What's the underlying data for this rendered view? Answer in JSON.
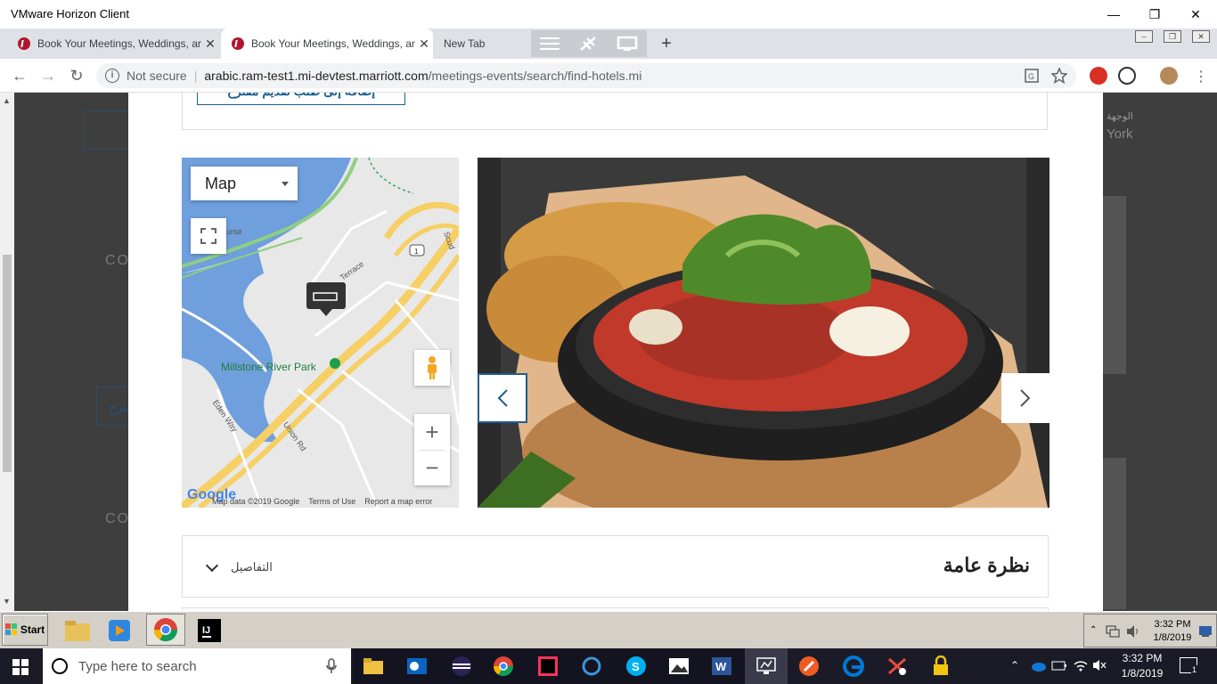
{
  "vmware": {
    "title": "VMware Horizon Client"
  },
  "tabs": [
    {
      "title": "Book Your Meetings, Weddings, and",
      "active": false
    },
    {
      "title": "Book Your Meetings, Weddings, and",
      "active": true
    },
    {
      "title": "New Tab",
      "active": false
    }
  ],
  "address": {
    "security": "Not secure",
    "host": "arabic.ram-test1.mi-devtest.marriott.com",
    "path": "/meetings-events/search/find-hotels.mi"
  },
  "background": {
    "right_label": "الوجهة",
    "right_value": "York",
    "left_ghost_1": "CO",
    "left_ghost_2": "CO",
    "left_button": "مقترح"
  },
  "page": {
    "add_button": "إضافة إلى طلب تقديم مقترح",
    "map": {
      "type_label": "Map",
      "park_label": "Millstone River Park",
      "streets": [
        "Eden Way",
        "Union Rd",
        "Terrace",
        "Scud",
        "urse"
      ],
      "route_badge": "1",
      "google_logo": "Google",
      "footer": [
        "Map data ©2019 Google",
        "Terms of Use",
        "Report a map error"
      ]
    },
    "overview": {
      "heading": "نظرة عامة",
      "details": "التفاصيل"
    }
  },
  "vm_taskbar": {
    "start": "Start",
    "clock_time": "3:32 PM",
    "clock_date": "1/8/2019"
  },
  "win_taskbar": {
    "search_placeholder": "Type here to search",
    "clock_time": "3:32 PM",
    "clock_date": "1/8/2019",
    "notifications": "1"
  },
  "colors": {
    "marriott_blue": "#1c5f8f",
    "map_water": "#6f9fdc",
    "map_highway": "#f6cf65"
  }
}
